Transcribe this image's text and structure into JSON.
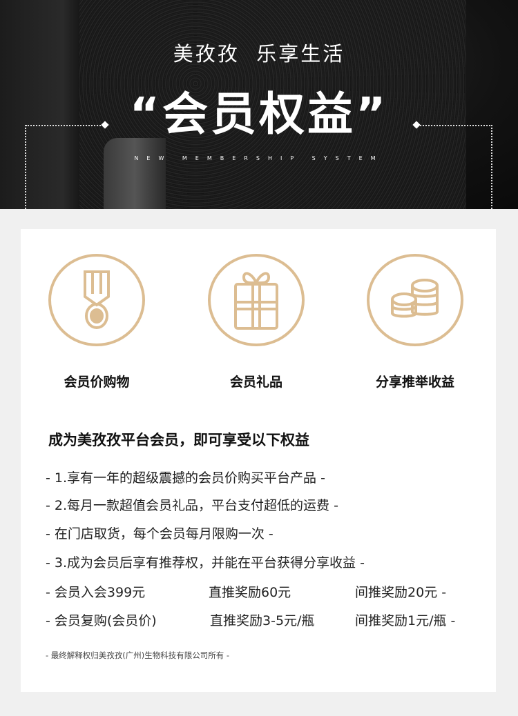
{
  "hero": {
    "subtitle": "美孜孜  乐享生活",
    "title": "“会员权益”",
    "english": "NEW MEMBERSHIP SYSTEM"
  },
  "benefits": [
    {
      "icon": "medal-icon",
      "label": "会员价购物"
    },
    {
      "icon": "gift-icon",
      "label": "会员礼品"
    },
    {
      "icon": "coins-icon",
      "label": "分享推举收益"
    }
  ],
  "heading": "成为美孜孜平台会员，即可享受以下权益",
  "items": [
    "- 1.享有一年的超级震撼的会员价购买平台产品 -",
    "- 2.每月一款超值会员礼品，平台支付超低的运费 -",
    "- 在门店取货，每个会员每月限购一次 -",
    "- 3.成为会员后享有推荐权，并能在平台获得分享收益 -"
  ],
  "rows": [
    {
      "a": "- 会员入会399元",
      "b": "直推奖励60元",
      "c": "间推奖励20元 -"
    },
    {
      "a": "- 会员复购(会员价)",
      "b": "直推奖励3-5元/瓶",
      "c": "间推奖励1元/瓶 -"
    }
  ],
  "footer": "- 最终解释权归美孜孜(广州)生物科技有限公司所有 -",
  "colors": {
    "accent": "#dcbd92"
  }
}
